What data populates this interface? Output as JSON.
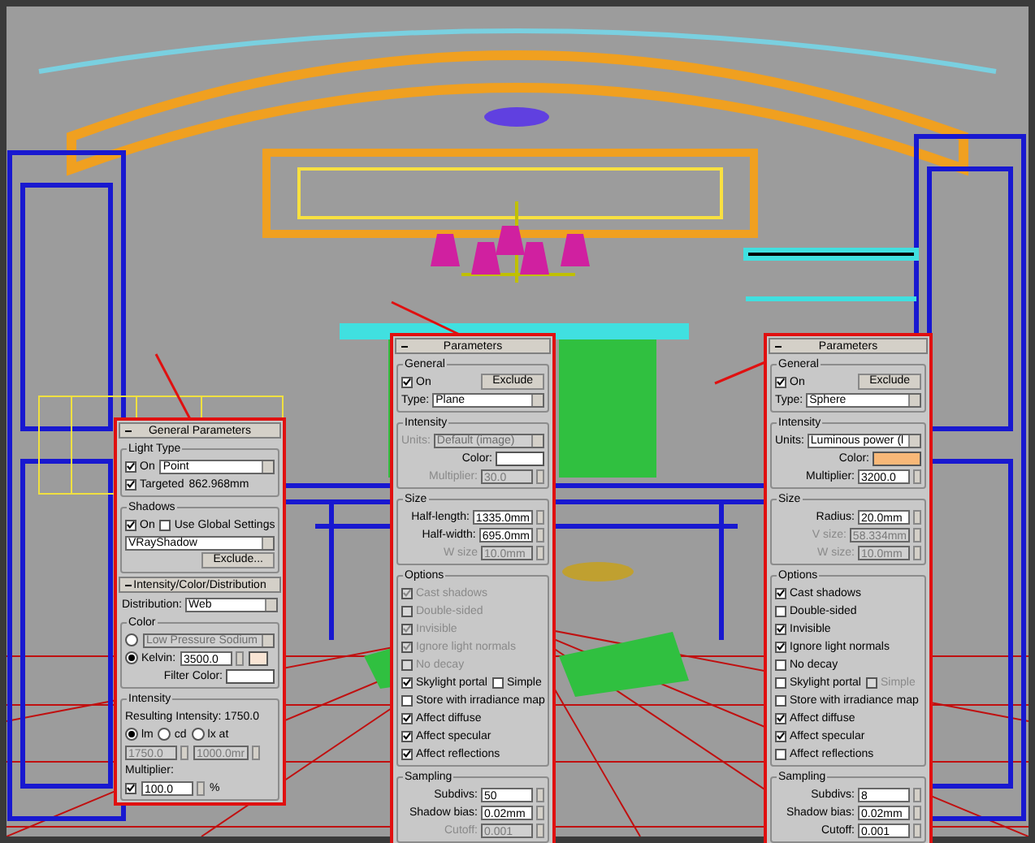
{
  "panels": [
    {
      "rollouts": [
        {
          "title": "General Parameters",
          "blocks": [
            {
              "title": "Light Type",
              "rows": [
                {
                  "items": [
                    {
                      "kind": "check",
                      "label": "On",
                      "checked": true
                    },
                    {
                      "kind": "dropdown",
                      "value": "Point"
                    }
                  ]
                },
                {
                  "items": [
                    {
                      "kind": "check",
                      "label": "Targeted",
                      "checked": true
                    },
                    {
                      "kind": "text",
                      "text": "862.968mm"
                    }
                  ]
                }
              ]
            },
            {
              "title": "Shadows",
              "rows": [
                {
                  "items": [
                    {
                      "kind": "check",
                      "label": "On",
                      "checked": true
                    },
                    {
                      "kind": "check",
                      "label": "Use Global Settings",
                      "checked": false
                    }
                  ]
                },
                {
                  "items": [
                    {
                      "kind": "dropdown",
                      "value": "VRayShadow"
                    }
                  ]
                },
                {
                  "items": [
                    {
                      "kind": "button",
                      "label": "Exclude..."
                    }
                  ]
                }
              ]
            }
          ]
        },
        {
          "title": "Intensity/Color/Distribution",
          "blocks": [
            {
              "rows": [
                {
                  "items": [
                    {
                      "kind": "dropdown",
                      "label": "Distribution:",
                      "value": "Web"
                    }
                  ]
                }
              ]
            },
            {
              "title": "Color",
              "rows": [
                {
                  "items": [
                    {
                      "kind": "radio",
                      "selected": false
                    },
                    {
                      "kind": "dropdown",
                      "value": "Low Pressure Sodium",
                      "disabled": true
                    }
                  ]
                },
                {
                  "items": [
                    {
                      "kind": "radio",
                      "label": "Kelvin:",
                      "selected": true
                    },
                    {
                      "kind": "spinner",
                      "value": "3500.0"
                    },
                    {
                      "kind": "swatch",
                      "color": "#f8e4d4"
                    }
                  ]
                },
                {
                  "items": [
                    {
                      "kind": "swatch",
                      "label": "Filter Color:",
                      "color": "#ffffff"
                    }
                  ]
                }
              ]
            },
            {
              "title": "Intensity",
              "rows": [
                {
                  "items": [
                    {
                      "kind": "text",
                      "text": "Resulting Intensity: 1750.0"
                    }
                  ]
                },
                {
                  "items": [
                    {
                      "kind": "radio",
                      "label": "lm",
                      "selected": true
                    },
                    {
                      "kind": "radio",
                      "label": "cd",
                      "selected": false
                    },
                    {
                      "kind": "radio",
                      "label": "lx at",
                      "selected": false
                    }
                  ]
                },
                {
                  "items": [
                    {
                      "kind": "spinner",
                      "value": "1750.0",
                      "disabled": true
                    },
                    {
                      "kind": "spinner",
                      "value": "1000.0mr",
                      "disabled": true
                    }
                  ]
                },
                {
                  "items": [
                    {
                      "kind": "text",
                      "text": "Multiplier:"
                    }
                  ]
                },
                {
                  "items": [
                    {
                      "kind": "check",
                      "checked": true
                    },
                    {
                      "kind": "spinner",
                      "value": "100.0"
                    },
                    {
                      "kind": "text",
                      "text": "%"
                    }
                  ]
                }
              ]
            }
          ]
        }
      ]
    },
    {
      "rollouts": [
        {
          "title": "Parameters",
          "blocks": [
            {
              "title": "General",
              "rows": [
                {
                  "items": [
                    {
                      "kind": "check",
                      "label": "On",
                      "checked": true
                    },
                    {
                      "kind": "button",
                      "label": "Exclude"
                    }
                  ]
                },
                {
                  "items": [
                    {
                      "kind": "dropdown",
                      "label": "Type:",
                      "value": "Plane"
                    }
                  ]
                }
              ]
            },
            {
              "title": "Intensity",
              "rows": [
                {
                  "items": [
                    {
                      "kind": "dropdown",
                      "label": "Units:",
                      "value": "Default (image)",
                      "disabled": true
                    }
                  ]
                },
                {
                  "items": [
                    {
                      "kind": "swatch",
                      "label": "Color:",
                      "color": "#ffffff"
                    }
                  ]
                },
                {
                  "items": [
                    {
                      "kind": "spinner",
                      "label": "Multiplier:",
                      "value": "30.0",
                      "disabled": true
                    }
                  ]
                }
              ]
            },
            {
              "title": "Size",
              "rows": [
                {
                  "items": [
                    {
                      "kind": "spinner",
                      "label": "Half-length:",
                      "value": "1335.0mm"
                    }
                  ]
                },
                {
                  "items": [
                    {
                      "kind": "spinner",
                      "label": "Half-width:",
                      "value": "695.0mm"
                    }
                  ]
                },
                {
                  "items": [
                    {
                      "kind": "spinner",
                      "label": "W size",
                      "value": "10.0mm",
                      "disabled": true
                    }
                  ]
                }
              ]
            },
            {
              "title": "Options",
              "rows": [
                {
                  "items": [
                    {
                      "kind": "check",
                      "label": "Cast shadows",
                      "checked": true,
                      "disabled": true
                    }
                  ]
                },
                {
                  "items": [
                    {
                      "kind": "check",
                      "label": "Double-sided",
                      "checked": false,
                      "disabled": true
                    }
                  ]
                },
                {
                  "items": [
                    {
                      "kind": "check",
                      "label": "Invisible",
                      "checked": true,
                      "disabled": true
                    }
                  ]
                },
                {
                  "items": [
                    {
                      "kind": "check",
                      "label": "Ignore light normals",
                      "checked": true,
                      "disabled": true
                    }
                  ]
                },
                {
                  "items": [
                    {
                      "kind": "check",
                      "label": "No decay",
                      "checked": false,
                      "disabled": true
                    }
                  ]
                },
                {
                  "items": [
                    {
                      "kind": "check",
                      "label": "Skylight portal",
                      "checked": true
                    },
                    {
                      "kind": "check",
                      "label": "Simple",
                      "checked": false
                    }
                  ]
                },
                {
                  "items": [
                    {
                      "kind": "check",
                      "label": "Store with irradiance map",
                      "checked": false
                    }
                  ]
                },
                {
                  "items": [
                    {
                      "kind": "check",
                      "label": "Affect diffuse",
                      "checked": true
                    }
                  ]
                },
                {
                  "items": [
                    {
                      "kind": "check",
                      "label": "Affect specular",
                      "checked": true
                    }
                  ]
                },
                {
                  "items": [
                    {
                      "kind": "check",
                      "label": "Affect reflections",
                      "checked": true
                    }
                  ]
                }
              ]
            },
            {
              "title": "Sampling",
              "rows": [
                {
                  "items": [
                    {
                      "kind": "spinner",
                      "label": "Subdivs:",
                      "value": "50"
                    }
                  ]
                },
                {
                  "items": [
                    {
                      "kind": "spinner",
                      "label": "Shadow bias:",
                      "value": "0.02mm"
                    }
                  ]
                },
                {
                  "items": [
                    {
                      "kind": "spinner",
                      "label": "Cutoff:",
                      "value": "0.001",
                      "disabled": true
                    }
                  ]
                }
              ]
            }
          ]
        }
      ]
    },
    {
      "rollouts": [
        {
          "title": "Parameters",
          "blocks": [
            {
              "title": "General",
              "rows": [
                {
                  "items": [
                    {
                      "kind": "check",
                      "label": "On",
                      "checked": true
                    },
                    {
                      "kind": "button",
                      "label": "Exclude"
                    }
                  ]
                },
                {
                  "items": [
                    {
                      "kind": "dropdown",
                      "label": "Type:",
                      "value": "Sphere"
                    }
                  ]
                }
              ]
            },
            {
              "title": "Intensity",
              "rows": [
                {
                  "items": [
                    {
                      "kind": "dropdown",
                      "label": "Units:",
                      "value": "Luminous power (l"
                    }
                  ]
                },
                {
                  "items": [
                    {
                      "kind": "swatch",
                      "label": "Color:",
                      "color": "#f8b878"
                    }
                  ]
                },
                {
                  "items": [
                    {
                      "kind": "spinner",
                      "label": "Multiplier:",
                      "value": "3200.0"
                    }
                  ]
                }
              ]
            },
            {
              "title": "Size",
              "rows": [
                {
                  "items": [
                    {
                      "kind": "spinner",
                      "label": "Radius:",
                      "value": "20.0mm"
                    }
                  ]
                },
                {
                  "items": [
                    {
                      "kind": "spinner",
                      "label": "V size:",
                      "value": "58.334mm",
                      "disabled": true
                    }
                  ]
                },
                {
                  "items": [
                    {
                      "kind": "spinner",
                      "label": "W size:",
                      "value": "10.0mm",
                      "disabled": true
                    }
                  ]
                }
              ]
            },
            {
              "title": "Options",
              "rows": [
                {
                  "items": [
                    {
                      "kind": "check",
                      "label": "Cast shadows",
                      "checked": true
                    }
                  ]
                },
                {
                  "items": [
                    {
                      "kind": "check",
                      "label": "Double-sided",
                      "checked": false
                    }
                  ]
                },
                {
                  "items": [
                    {
                      "kind": "check",
                      "label": "Invisible",
                      "checked": true
                    }
                  ]
                },
                {
                  "items": [
                    {
                      "kind": "check",
                      "label": "Ignore light normals",
                      "checked": true
                    }
                  ]
                },
                {
                  "items": [
                    {
                      "kind": "check",
                      "label": "No decay",
                      "checked": false
                    }
                  ]
                },
                {
                  "items": [
                    {
                      "kind": "check",
                      "label": "Skylight portal",
                      "checked": false
                    },
                    {
                      "kind": "check",
                      "label": "Simple",
                      "checked": false,
                      "disabled": true
                    }
                  ]
                },
                {
                  "items": [
                    {
                      "kind": "check",
                      "label": "Store with irradiance map",
                      "checked": false
                    }
                  ]
                },
                {
                  "items": [
                    {
                      "kind": "check",
                      "label": "Affect diffuse",
                      "checked": true
                    }
                  ]
                },
                {
                  "items": [
                    {
                      "kind": "check",
                      "label": "Affect specular",
                      "checked": true
                    }
                  ]
                },
                {
                  "items": [
                    {
                      "kind": "check",
                      "label": "Affect reflections",
                      "checked": false
                    }
                  ]
                }
              ]
            },
            {
              "title": "Sampling",
              "rows": [
                {
                  "items": [
                    {
                      "kind": "spinner",
                      "label": "Subdivs:",
                      "value": "8"
                    }
                  ]
                },
                {
                  "items": [
                    {
                      "kind": "spinner",
                      "label": "Shadow bias:",
                      "value": "0.02mm"
                    }
                  ]
                },
                {
                  "items": [
                    {
                      "kind": "spinner",
                      "label": "Cutoff:",
                      "value": "0.001"
                    }
                  ]
                }
              ]
            }
          ]
        }
      ]
    }
  ]
}
